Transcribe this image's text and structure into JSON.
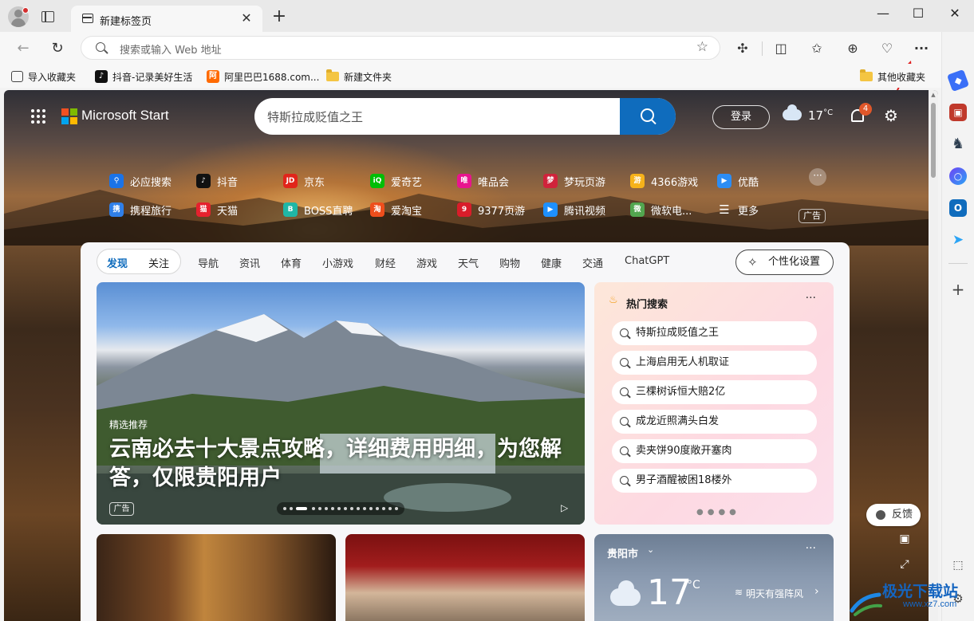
{
  "tab": {
    "title": "新建标签页",
    "close": "✕",
    "new": "+"
  },
  "window": {
    "minimize": "—",
    "maximize": "☐",
    "close": "✕"
  },
  "address": {
    "placeholder": "搜索或输入 Web 地址"
  },
  "favorites": [
    {
      "label": "导入收藏夹",
      "icon": "import-icon"
    },
    {
      "label": "抖音-记录美好生活",
      "icon": "douyin-icon",
      "color": "#111111"
    },
    {
      "label": "阿里巴巴1688.com...",
      "icon": "alibaba-icon",
      "color": "#ff6a00"
    },
    {
      "label": "新建文件夹",
      "icon": "folder-icon"
    },
    {
      "label": "其他收藏夹",
      "icon": "folder-icon"
    }
  ],
  "page": {
    "brand": "Microsoft Start",
    "search_query": "特斯拉成贬值之王",
    "login": "登录",
    "temperature": "17",
    "temperature_unit": "°C",
    "notification_count": "4"
  },
  "quicklinks": [
    {
      "label": "必应搜索",
      "color": "#1a73e8",
      "glyph": "⚲"
    },
    {
      "label": "抖音",
      "color": "#111111",
      "glyph": "♪"
    },
    {
      "label": "京东",
      "color": "#e1251b",
      "glyph": "JD"
    },
    {
      "label": "爱奇艺",
      "color": "#00be06",
      "glyph": "iQ"
    },
    {
      "label": "唯品会",
      "color": "#e8158e",
      "glyph": "唯"
    },
    {
      "label": "梦玩页游",
      "color": "#d0233b",
      "glyph": "梦"
    },
    {
      "label": "4366游戏",
      "color": "#f6b21a",
      "glyph": "游"
    },
    {
      "label": "优酷",
      "color": "#2c8df4",
      "glyph": "▶"
    },
    {
      "label": "携程旅行",
      "color": "#2f7fe8",
      "glyph": "携"
    },
    {
      "label": "天猫",
      "color": "#e5212e",
      "glyph": "猫"
    },
    {
      "label": "BOSS直聘",
      "color": "#20b7a6",
      "glyph": "B"
    },
    {
      "label": "爱淘宝",
      "color": "#ee4e1c",
      "glyph": "淘"
    },
    {
      "label": "9377页游",
      "color": "#d91d2a",
      "glyph": "9"
    },
    {
      "label": "腾讯视频",
      "color": "#1e90ff",
      "glyph": "▶"
    },
    {
      "label": "微软电...",
      "color": "#52a64f",
      "glyph": "微"
    },
    {
      "label": "更多",
      "color": "transparent",
      "glyph": "☰"
    }
  ],
  "quicklinks_ad": "广告",
  "feed": {
    "segments": [
      "发现",
      "关注"
    ],
    "nav": [
      "导航",
      "资讯",
      "体育",
      "小游戏",
      "财经",
      "游戏",
      "天气",
      "购物",
      "健康",
      "交通",
      "ChatGPT"
    ],
    "personalize": "个性化设置"
  },
  "hero": {
    "tag": "精选推荐",
    "title": "云南必去十大景点攻略，详细费用明细，为您解答，仅限贵阳用户",
    "ad": "广告"
  },
  "hot_search": {
    "title": "热门搜索",
    "items": [
      "特斯拉成贬值之王",
      "上海启用无人机取证",
      "三棵树诉恒大赔2亿",
      "成龙近照满头白发",
      "卖夹饼90度敞开塞肉",
      "男子酒醒被困18楼外"
    ]
  },
  "weather": {
    "city": "贵阳市",
    "temp": "17",
    "unit": "°C",
    "note": "明天有强阵风"
  },
  "feedback": "反馈",
  "watermark": {
    "title": "极光下载站",
    "url": "www.xz7.com"
  }
}
